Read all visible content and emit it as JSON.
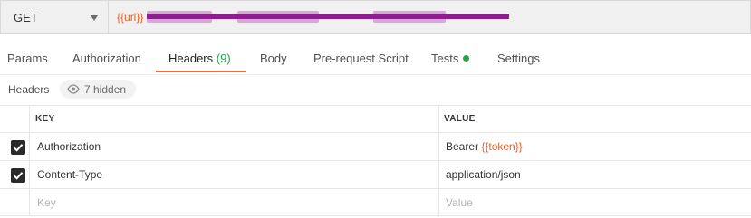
{
  "request": {
    "method": "GET",
    "url_variable": "{{url}}"
  },
  "tabs": [
    {
      "label": "Params"
    },
    {
      "label": "Authorization"
    },
    {
      "label": "Headers",
      "count": "(9)"
    },
    {
      "label": "Body"
    },
    {
      "label": "Pre-request Script"
    },
    {
      "label": "Tests"
    },
    {
      "label": "Settings"
    }
  ],
  "active_tab": "Headers",
  "headers_section": {
    "title": "Headers",
    "hidden_label": "7 hidden"
  },
  "table": {
    "columns": [
      "KEY",
      "VALUE"
    ],
    "rows": [
      {
        "checked": true,
        "key": "Authorization",
        "value_prefix": "Bearer ",
        "value_var": "{{token}}"
      },
      {
        "checked": true,
        "key": "Content-Type",
        "value_prefix": "application/json",
        "value_var": ""
      }
    ],
    "new_row": {
      "key_placeholder": "Key",
      "value_placeholder": "Value"
    }
  },
  "colors": {
    "accent": "#f26b3a",
    "variable": "#e6622b",
    "success": "#29a348",
    "redaction": "#8e1d90"
  },
  "icons": {
    "method_dropdown": "chevron-down-icon",
    "hidden": "eye-icon",
    "checkbox": "checkmark-icon",
    "tests_status": "status-dot-icon"
  }
}
